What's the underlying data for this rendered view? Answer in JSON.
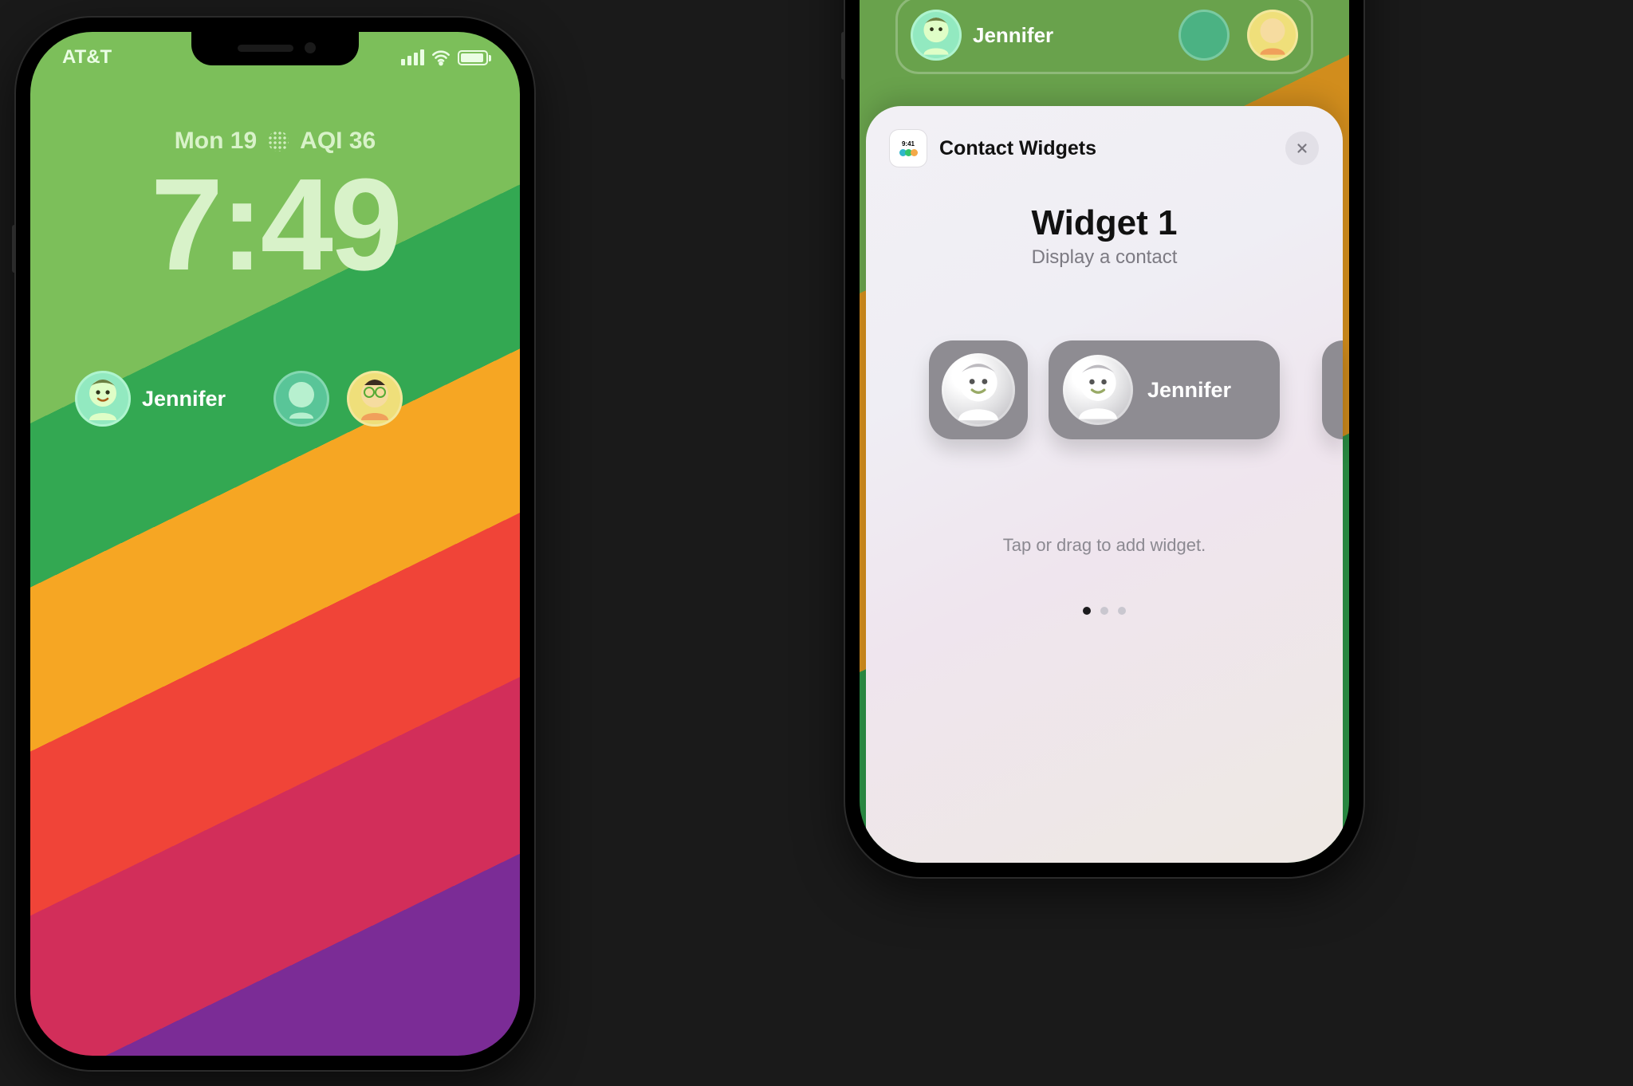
{
  "phone_left": {
    "status": {
      "carrier": "AT&T"
    },
    "lock": {
      "date": "Mon 19",
      "aqi": "AQI 36",
      "time": "7:49"
    },
    "widgets": {
      "primary_contact_name": "Jennifer"
    }
  },
  "phone_right": {
    "top_strip": {
      "primary_contact_name": "Jennifer"
    },
    "sheet": {
      "app_name": "Contact Widgets",
      "app_time_badge": "9:41",
      "title": "Widget 1",
      "subtitle": "Display a contact",
      "sample_contact_name": "Jennifer",
      "hint": "Tap or drag to add widget.",
      "page_count": 3,
      "page_active": 0
    }
  }
}
